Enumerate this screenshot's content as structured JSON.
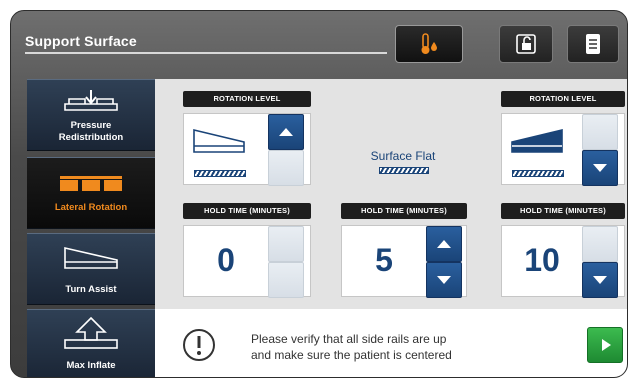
{
  "header": {
    "title": "Support Surface",
    "buttons": [
      {
        "name": "temperature-moisture-icon",
        "active": true
      },
      {
        "name": "unlock-icon",
        "active": false
      },
      {
        "name": "document-icon",
        "active": false
      }
    ]
  },
  "sidebar": {
    "items": [
      {
        "label_line1": "Pressure",
        "label_line2": "Redistribution",
        "icon": "pressure-redistribution-icon"
      },
      {
        "label_line1": "Lateral Rotation",
        "label_line2": "",
        "icon": "lateral-rotation-icon",
        "active": true
      },
      {
        "label_line1": "Turn Assist",
        "label_line2": "",
        "icon": "turn-assist-icon"
      },
      {
        "label_line1": "Max Inflate",
        "label_line2": "",
        "icon": "max-inflate-icon"
      }
    ]
  },
  "left_column": {
    "rotation_header": "ROTATION LEVEL",
    "hold_header": "HOLD TIME (MINUTES)",
    "hold_value": "0",
    "rotation_up_enabled": true,
    "rotation_down_enabled": false,
    "hold_up_enabled": false,
    "hold_down_enabled": false
  },
  "center_column": {
    "surface_label": "Surface Flat",
    "hold_header": "HOLD TIME (MINUTES)",
    "hold_value": "5",
    "hold_up_enabled": true,
    "hold_down_enabled": true
  },
  "right_column": {
    "rotation_header": "ROTATION LEVEL",
    "hold_header": "HOLD TIME (MINUTES)",
    "hold_value": "10",
    "rotation_up_enabled": false,
    "rotation_down_enabled": true,
    "hold_up_enabled": false,
    "hold_down_enabled": true
  },
  "message": {
    "line1": "Please verify that all side rails are up",
    "line2": "and make sure the patient is centered"
  },
  "colors": {
    "accent_blue": "#1a4478",
    "active_orange": "#f08a1e",
    "start_green": "#2fa843"
  }
}
